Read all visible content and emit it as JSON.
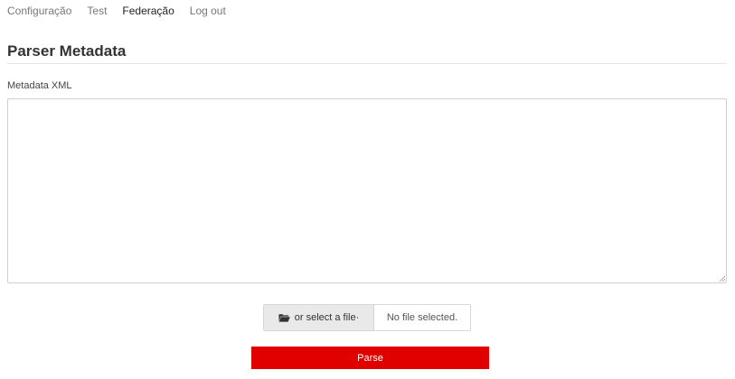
{
  "nav": {
    "items": [
      {
        "label": "Configuração"
      },
      {
        "label": "Test"
      },
      {
        "label": "Federação"
      },
      {
        "label": "Log out"
      }
    ],
    "active": "Federação"
  },
  "page": {
    "title": "Parser Metadata"
  },
  "form": {
    "label": "Metadata XML",
    "textarea_value": "",
    "file": {
      "button_label": "or select a file·",
      "button_icon": "folder-open-icon",
      "status": "No file selected."
    },
    "submit_label": "Parse"
  },
  "colors": {
    "accent": "#e00000",
    "file_button_bg": "#e9e9e9",
    "border": "#cfcfcf"
  }
}
